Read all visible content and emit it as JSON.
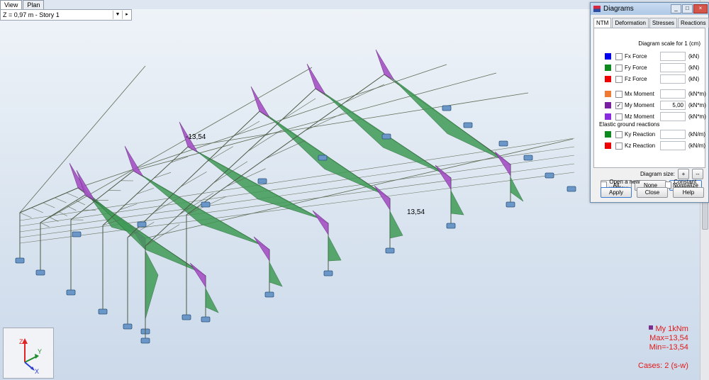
{
  "view_tabs": [
    "View",
    "Plan"
  ],
  "story_bar": {
    "text": "Z = 0,97 m - Story 1"
  },
  "model_labels": {
    "label_a": "-13,54",
    "label_b": "13,54"
  },
  "legend": {
    "line1": "My  1kNm",
    "line2": "Max=13,54",
    "line3": "Min=-13,54",
    "line4": "Cases: 2 (s-w)"
  },
  "axis": {
    "z": "Z",
    "y": "Y",
    "x": "X"
  },
  "dialog": {
    "title": "Diagrams",
    "tabs": [
      "NTM",
      "Deformation",
      "Stresses",
      "Reactions"
    ],
    "scale_label": "Diagram scale for 1  (cm)",
    "rows": [
      {
        "name": "Fx Force",
        "value": "",
        "unit": "(kN)",
        "color": "#0000ee",
        "checked": false
      },
      {
        "name": "Fy Force",
        "value": "",
        "unit": "(kN)",
        "color": "#0c8a1e",
        "checked": false
      },
      {
        "name": "Fz Force",
        "value": "",
        "unit": "(kN)",
        "color": "#ee0000",
        "checked": false
      },
      {
        "name": "Mx Moment",
        "value": "",
        "unit": "(kN*m)",
        "color": "#f07a32",
        "checked": false
      },
      {
        "name": "My Moment",
        "value": "5,00",
        "unit": "(kN*m)",
        "color": "#7b1fa2",
        "checked": true
      },
      {
        "name": "Mz Moment",
        "value": "",
        "unit": "(kN*m)",
        "color": "#8a2be2",
        "checked": false
      }
    ],
    "elastic_label": "Elastic ground reactions",
    "elastic_rows": [
      {
        "name": "Ky Reaction",
        "value": "",
        "unit": "(kN/m)",
        "color": "#0c8a1e",
        "checked": false
      },
      {
        "name": "Kz Reaction",
        "value": "",
        "unit": "(kN/m)",
        "color": "#ee0000",
        "checked": false
      }
    ],
    "buttons": {
      "all": "All",
      "none": "None",
      "normalize": "Normalize"
    },
    "diagram_size": "Diagram size:",
    "plus": "+",
    "minus": "--",
    "open_new_window": "Open a new window",
    "constant_scale": "Constant scale",
    "apply": "Apply",
    "close": "Close",
    "help": "Help"
  }
}
